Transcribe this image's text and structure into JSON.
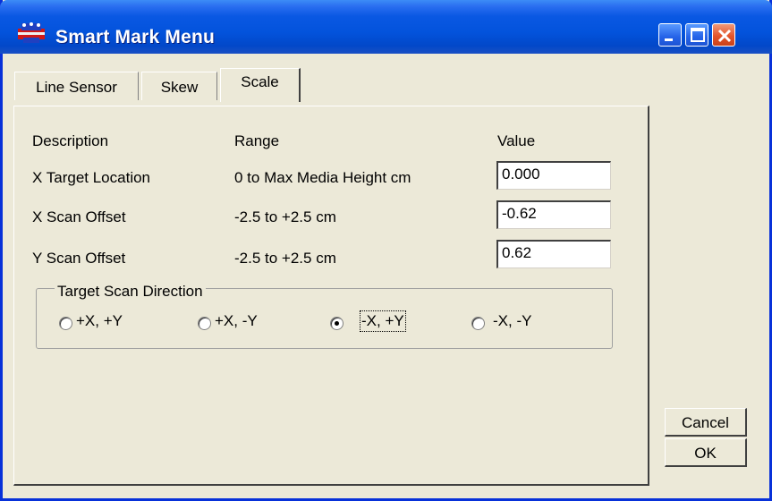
{
  "window": {
    "title": "Smart Mark Menu",
    "app_icon": "printer-icon"
  },
  "titlebar_buttons": [
    "minimize-icon",
    "maximize-icon",
    "close-icon"
  ],
  "tabs": [
    {
      "label": "Line Sensor",
      "active": false
    },
    {
      "label": "Skew",
      "active": false
    },
    {
      "label": "Scale",
      "active": true
    }
  ],
  "headers": {
    "description": "Description",
    "range": "Range",
    "value": "Value"
  },
  "rows": [
    {
      "description": "X Target Location",
      "range": "0 to Max Media Height cm",
      "value": "0.000"
    },
    {
      "description": "X Scan Offset",
      "range": "-2.5 to +2.5 cm",
      "value": "-0.62"
    },
    {
      "description": "Y Scan Offset",
      "range": "-2.5 to +2.5 cm",
      "value": "0.62"
    }
  ],
  "scan_direction": {
    "title": "Target Scan Direction",
    "options": [
      "+X, +Y",
      "+X, -Y",
      "-X, +Y",
      "-X, -Y"
    ],
    "selected": "-X, +Y"
  },
  "buttons": {
    "cancel": "Cancel",
    "ok": "OK"
  }
}
